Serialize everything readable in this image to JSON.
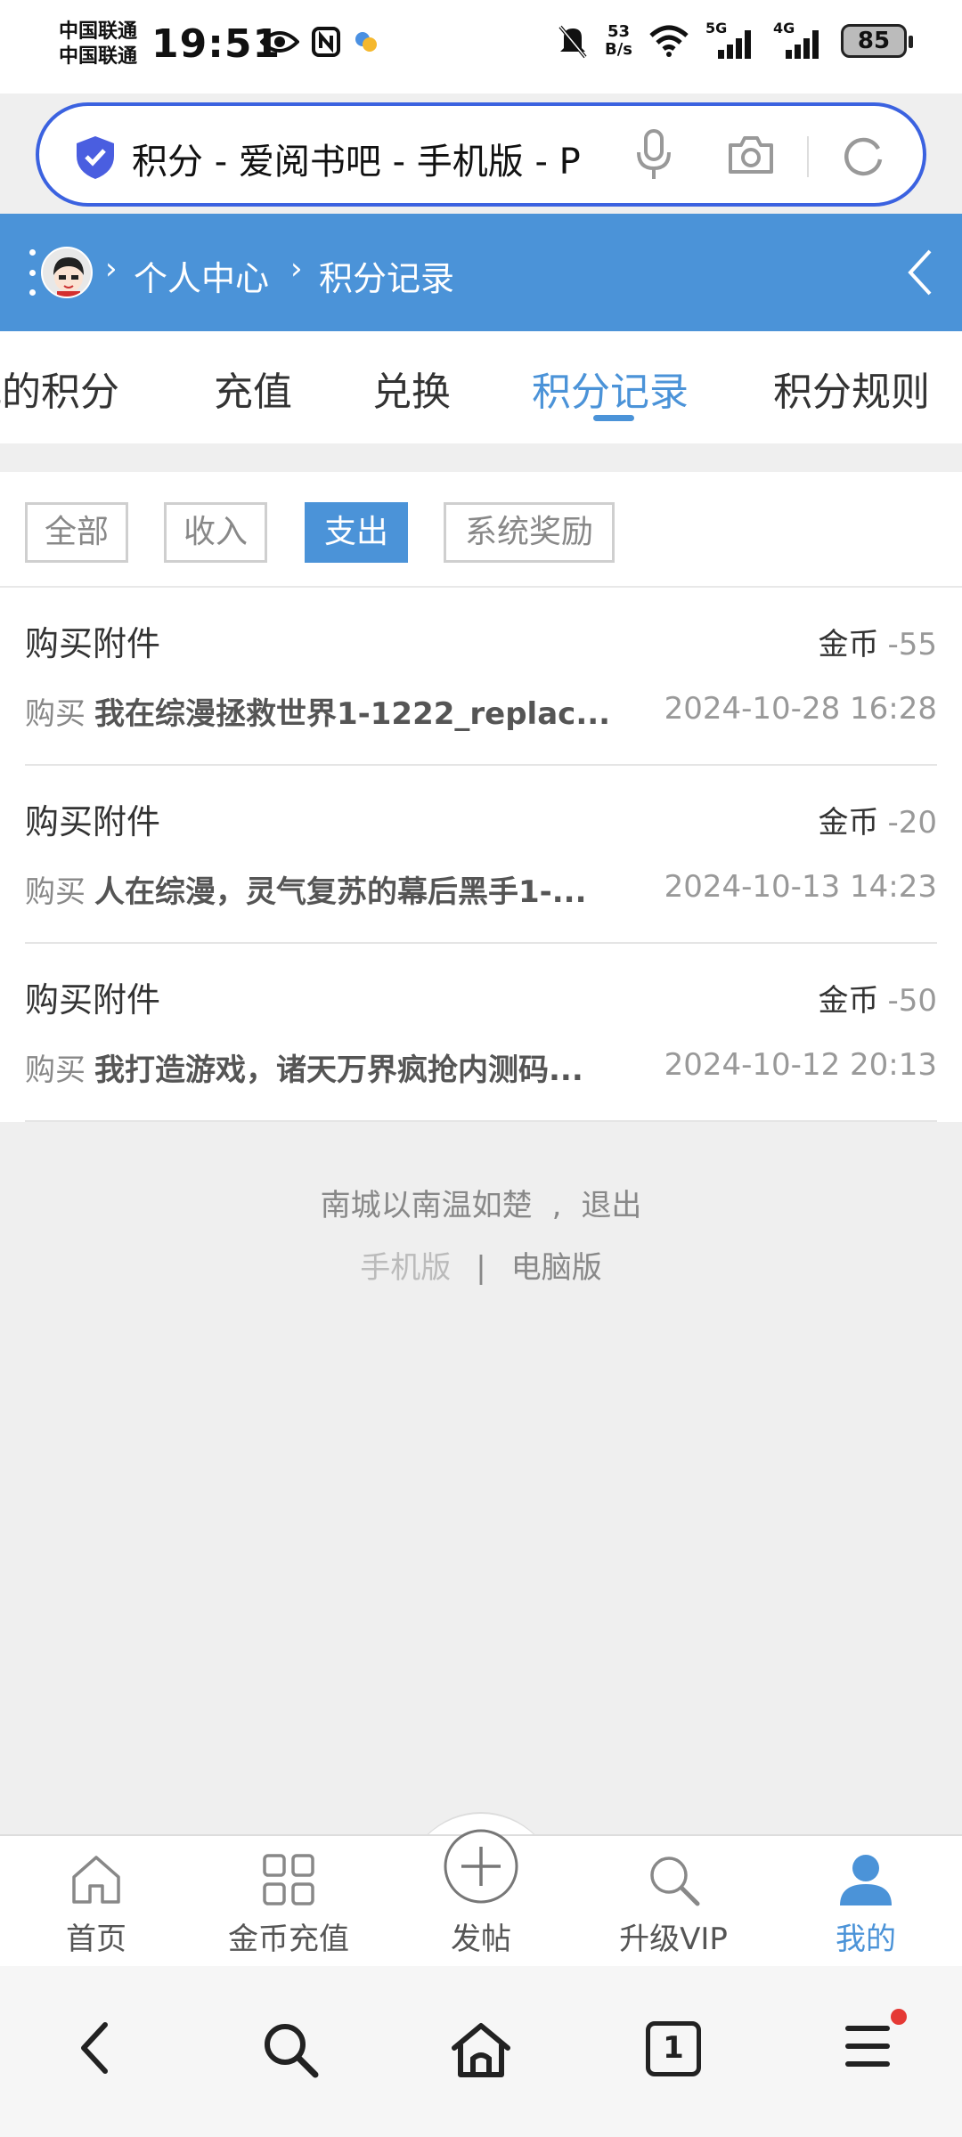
{
  "status_bar": {
    "carrier_1": "中国联通",
    "carrier_2": "中国联通",
    "time": "19:51",
    "net_speed_value": "53",
    "net_speed_unit": "B/s",
    "signal_1": "5G",
    "signal_2": "4G",
    "battery": "85"
  },
  "browser": {
    "url_title": "积分 - 爱阅书吧 - 手机版 - P",
    "accent_color": "#3b62e0"
  },
  "header": {
    "breadcrumb_1": "个人中心",
    "breadcrumb_2": "积分记录",
    "separator": "›",
    "background_color": "#4b93d8"
  },
  "tabs": [
    {
      "label": "我的积分"
    },
    {
      "label": "充值"
    },
    {
      "label": "兑换"
    },
    {
      "label": "积分记录"
    },
    {
      "label": "积分规则"
    }
  ],
  "filters": [
    {
      "label": "全部"
    },
    {
      "label": "收入"
    },
    {
      "label": "支出"
    },
    {
      "label": "系统奖励"
    }
  ],
  "records": [
    {
      "title": "购买附件",
      "currency": "金币",
      "amount": "-55",
      "action": "购买",
      "item": "我在综漫拯救世界1-1222_replac...",
      "time": "2024-10-28 16:28"
    },
    {
      "title": "购买附件",
      "currency": "金币",
      "amount": "-20",
      "action": "购买",
      "item": "人在综漫，灵气复苏的幕后黑手1-...",
      "time": "2024-10-13 14:23"
    },
    {
      "title": "购买附件",
      "currency": "金币",
      "amount": "-50",
      "action": "购买",
      "item": "我打造游戏，诸天万界疯抢内测码...",
      "time": "2024-10-12 20:13"
    }
  ],
  "footer": {
    "username": "南城以南温如楚",
    "comma": ",",
    "logout": "退出",
    "mobile": "手机版",
    "divider": "|",
    "desktop": "电脑版"
  },
  "bottom_nav": [
    {
      "label": "首页",
      "icon": "home-icon"
    },
    {
      "label": "金币充值",
      "icon": "grid-icon"
    },
    {
      "label": "发帖",
      "icon": "plus-circle-icon"
    },
    {
      "label": "升级VIP",
      "icon": "search-icon"
    },
    {
      "label": "我的",
      "icon": "user-icon"
    }
  ],
  "system_nav": {
    "tab_count": "1"
  }
}
